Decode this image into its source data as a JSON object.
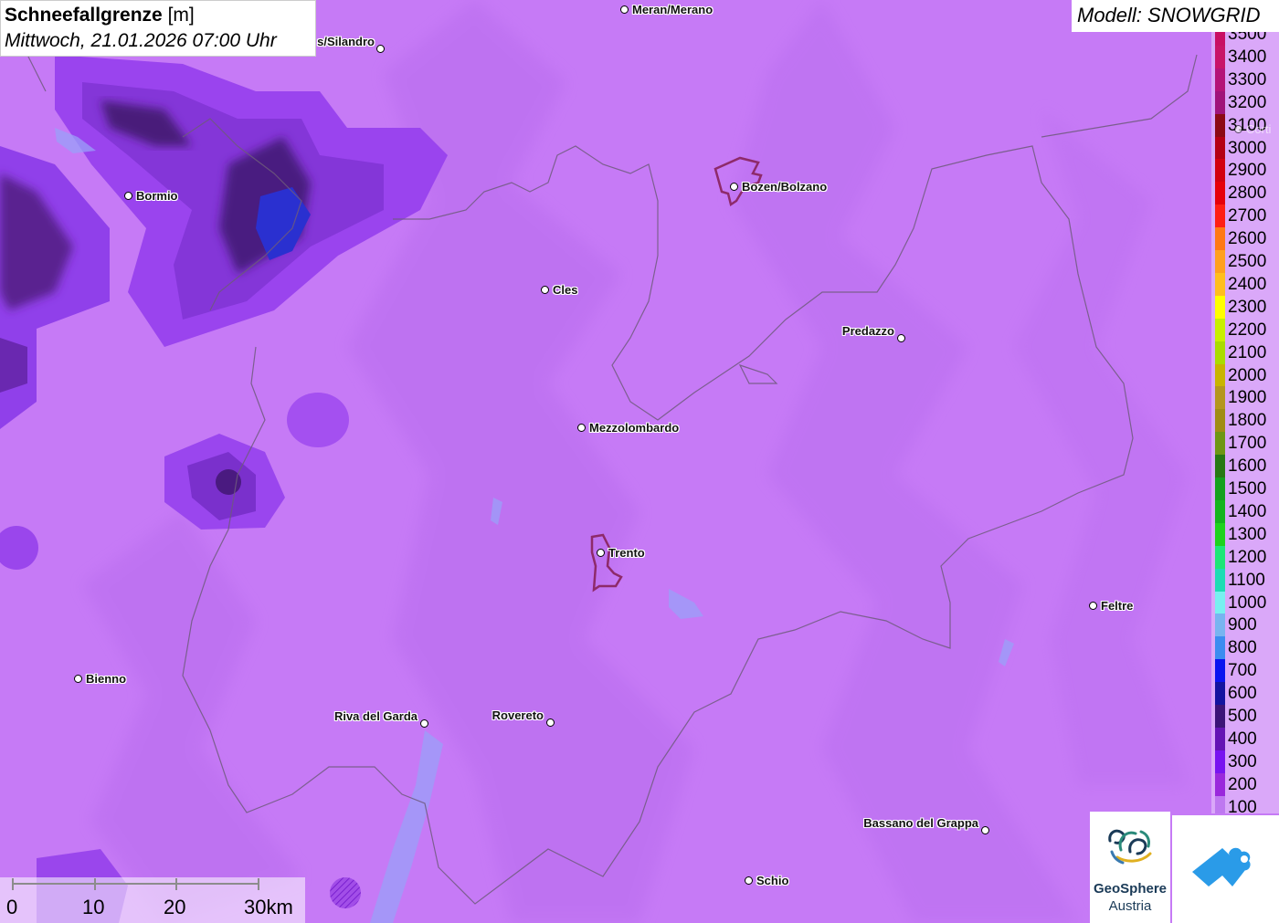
{
  "title": {
    "main": "Schneefallgrenze",
    "unit": "[m]",
    "datetime": "Mittwoch, 21.01.2026 07:00 Uhr"
  },
  "model": "Modell: SNOWGRID",
  "legend": [
    {
      "value": "3500",
      "color": "#c80f64"
    },
    {
      "value": "3400",
      "color": "#c81468"
    },
    {
      "value": "3300",
      "color": "#b41478"
    },
    {
      "value": "3200",
      "color": "#a0147a"
    },
    {
      "value": "3100",
      "color": "#8c0a14"
    },
    {
      "value": "3000",
      "color": "#b40014"
    },
    {
      "value": "2900",
      "color": "#d2000f"
    },
    {
      "value": "2800",
      "color": "#e6000a"
    },
    {
      "value": "2700",
      "color": "#ff1e14"
    },
    {
      "value": "2600",
      "color": "#ff7814"
    },
    {
      "value": "2500",
      "color": "#ffa01e"
    },
    {
      "value": "2400",
      "color": "#ffbe1e"
    },
    {
      "value": "2300",
      "color": "#ffff00"
    },
    {
      "value": "2200",
      "color": "#c8f000"
    },
    {
      "value": "2100",
      "color": "#aadc00"
    },
    {
      "value": "2000",
      "color": "#c8b400"
    },
    {
      "value": "1900",
      "color": "#b4961e"
    },
    {
      "value": "1800",
      "color": "#a08c14"
    },
    {
      "value": "1700",
      "color": "#6e9614"
    },
    {
      "value": "1600",
      "color": "#287814"
    },
    {
      "value": "1500",
      "color": "#14a01e"
    },
    {
      "value": "1400",
      "color": "#14b41e"
    },
    {
      "value": "1300",
      "color": "#1ed21e"
    },
    {
      "value": "1200",
      "color": "#1ee678"
    },
    {
      "value": "1100",
      "color": "#1edcb4"
    },
    {
      "value": "1000",
      "color": "#78f0f0"
    },
    {
      "value": "900",
      "color": "#78b4f0"
    },
    {
      "value": "800",
      "color": "#3c8cf0"
    },
    {
      "value": "700",
      "color": "#0a14f0"
    },
    {
      "value": "600",
      "color": "#1414a0"
    },
    {
      "value": "500",
      "color": "#3c1478"
    },
    {
      "value": "400",
      "color": "#6414b4"
    },
    {
      "value": "300",
      "color": "#7814f0"
    },
    {
      "value": "200",
      "color": "#9a28dc"
    },
    {
      "value": "100",
      "color": "#be78f0"
    }
  ],
  "cities": [
    {
      "name": "Meran/Merano"
    },
    {
      "name": "s/Silandro"
    },
    {
      "name": "Bormio"
    },
    {
      "name": "Bozen/Bolzano"
    },
    {
      "name": "Cles"
    },
    {
      "name": "Predazzo"
    },
    {
      "name": "Mezzolombardo"
    },
    {
      "name": "Trento"
    },
    {
      "name": "Feltre"
    },
    {
      "name": "Bienno"
    },
    {
      "name": "Riva del Garda"
    },
    {
      "name": "Rovereto"
    },
    {
      "name": "Bassano del Grappa"
    },
    {
      "name": "Schio"
    },
    {
      "name": "Corti"
    }
  ],
  "scale": {
    "labels": [
      "0",
      "10",
      "20",
      "30km"
    ]
  },
  "logos": {
    "geosphere_line1": "GeoSphere",
    "geosphere_line2": "Austria"
  }
}
